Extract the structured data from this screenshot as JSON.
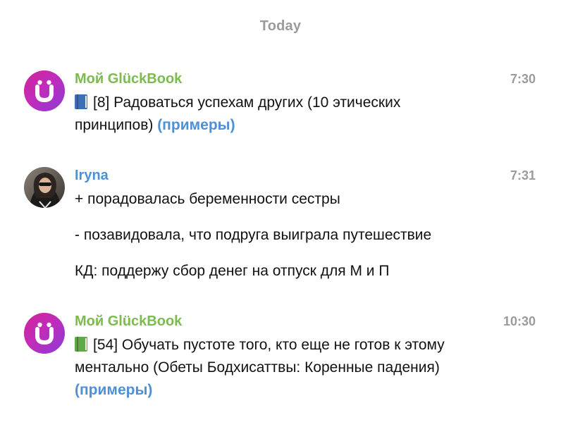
{
  "date_separator": "Today",
  "colors": {
    "brand_sender": "#7cbc4f",
    "user_sender": "#4e8fd6",
    "link": "#4e8fd6",
    "book_blue": "#3d6fb6",
    "book_green": "#5fa84a",
    "muted": "#9b9b9b"
  },
  "messages": [
    {
      "sender": "Мой GlückBook",
      "time": "7:30",
      "avatar_icon": "glueckbook-logo-icon",
      "book_icon": "blue-book-icon",
      "text": "[8] Радоваться успехам других (10 этических принципов)",
      "link": "(примеры)"
    },
    {
      "sender": "Iryna",
      "time": "7:31",
      "avatar_icon": "user-photo-avatar",
      "lines": [
        "+ порадовалась беременности сестры",
        "- позавидовала, что подруга выиграла путешествие",
        "КД: поддержу сбор денег на отпуск для М и П"
      ]
    },
    {
      "sender": "Мой GlückBook",
      "time": "10:30",
      "avatar_icon": "glueckbook-logo-icon",
      "book_icon": "green-book-icon",
      "text": "[54] Обучать пустоте того, кто еще не готов к этому ментально (Обеты Бодхисаттвы: Коренные падения)",
      "link": "(примеры)"
    }
  ]
}
